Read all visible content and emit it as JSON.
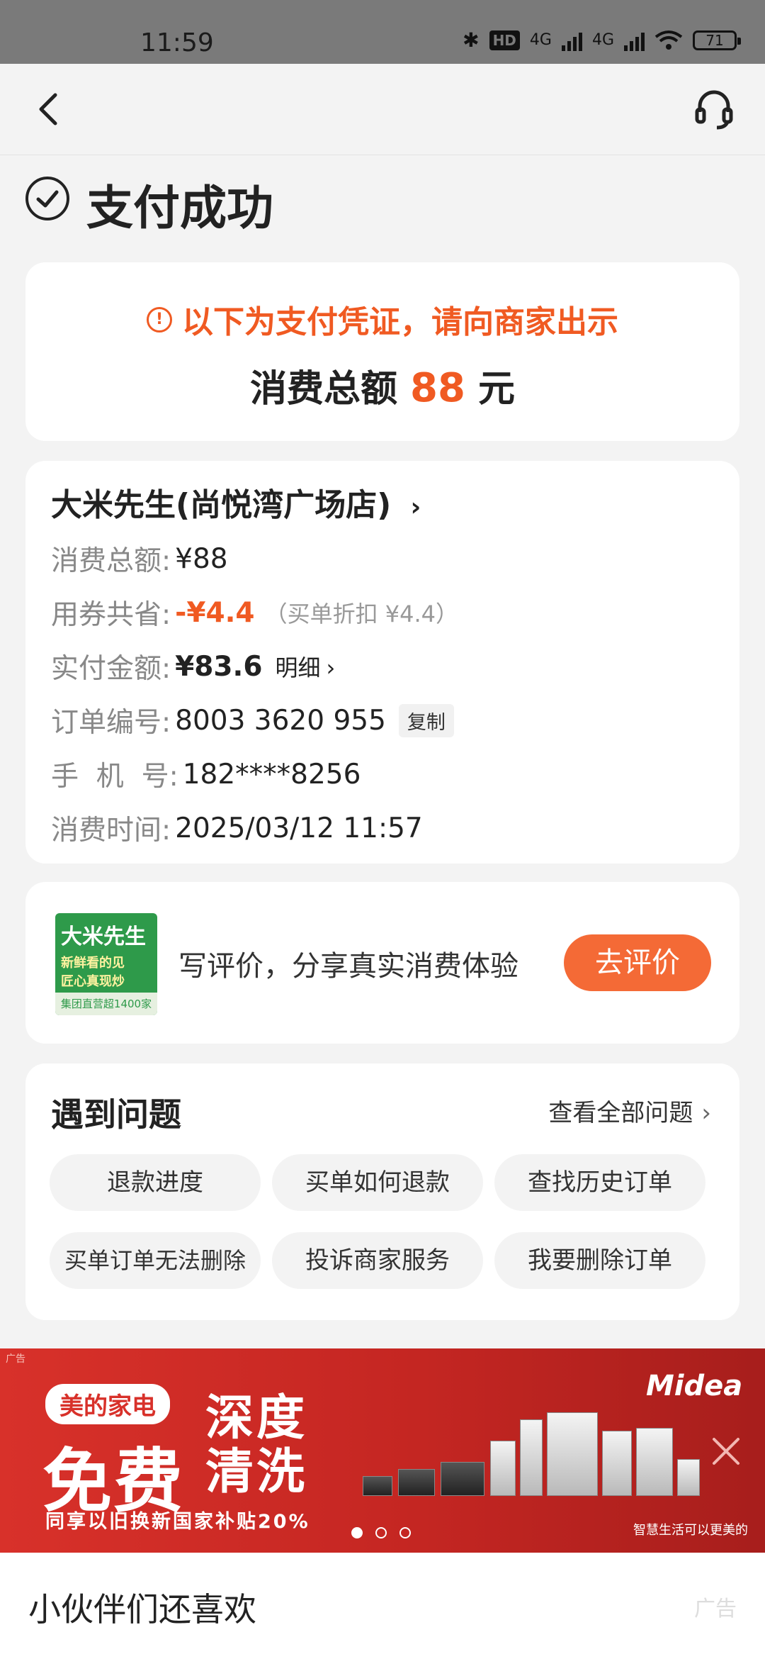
{
  "status_bar": {
    "time": "11:59",
    "hd": "HD",
    "net1": "4G",
    "net2": "4G",
    "battery": "71"
  },
  "page": {
    "title": "支付成功"
  },
  "voucher": {
    "warning": "以下为支付凭证，请向商家出示",
    "total_label": "消费总额",
    "total_amount": "88",
    "total_unit": "元"
  },
  "order": {
    "shop_name": "大米先生(尚悦湾广场店)",
    "rows": [
      {
        "label": "消费总额:",
        "value": "¥88"
      },
      {
        "label": "用券共省:",
        "value": "-¥4.4",
        "sub": "（买单折扣 ¥4.4）"
      },
      {
        "label": "实付金额:",
        "value": "¥83.6",
        "action": "明细"
      },
      {
        "label": "订单编号:",
        "value": "8003 3620 955",
        "action": "复制"
      },
      {
        "label": "手  机  号:",
        "value": "182****8256"
      },
      {
        "label": "消费时间:",
        "value": "2025/03/12 11:57"
      }
    ]
  },
  "review": {
    "logo_line1": "大米先生",
    "logo_line2": "新鲜看的见",
    "logo_line3": "匠心真现炒",
    "logo_line4": "集团直营超1400家",
    "text": "写评价，分享真实消费体验",
    "button": "去评价"
  },
  "faq": {
    "title": "遇到问题",
    "view_all": "查看全部问题",
    "chips": [
      "退款进度",
      "买单如何退款",
      "查找历史订单",
      "买单订单无法删除",
      "投诉商家服务",
      "我要删除订单"
    ]
  },
  "ad": {
    "tag": "广告",
    "pill": "美的家电",
    "line_a": "深度",
    "line_free": "免费",
    "line_b": "清洗",
    "sub": "同享以旧换新国家补贴20%",
    "brand": "Midea",
    "slogan": "智慧生活可以更美的",
    "slide_count": 3,
    "active_slide": 1
  },
  "recommend": {
    "title": "小伙伴们还喜欢",
    "ad_label": "广告"
  }
}
